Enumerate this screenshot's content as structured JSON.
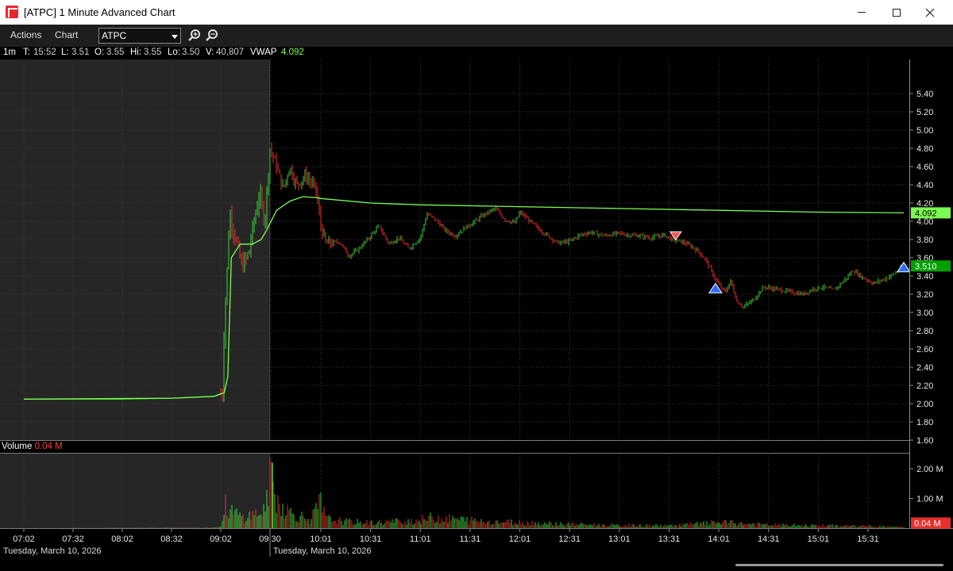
{
  "window": {
    "title": "[ATPC] 1 Minute Advanced Chart"
  },
  "menu": {
    "actions": "Actions",
    "chart": "Chart",
    "symbol": "ATPC"
  },
  "icons": {
    "app": "app-icon",
    "zoom_in": "zoom-in-icon",
    "zoom_out": "zoom-out-icon",
    "minimize": "minimize-icon",
    "maximize": "maximize-icon",
    "close": "close-icon"
  },
  "info": {
    "interval": "1m",
    "t_label": "T:",
    "t_value": "15:52",
    "l_label": "L:",
    "l_value": "3.51",
    "o_label": "O:",
    "o_value": "3.55",
    "hi_label": "Hi:",
    "hi_value": "3.55",
    "lo_label": "Lo:",
    "lo_value": "3.50",
    "v_label": "V:",
    "v_value": "40,807",
    "vwap_label": "VWAP",
    "vwap_value": "4.092"
  },
  "volume_panel": {
    "label": "Volume",
    "value": "0.04 M"
  },
  "dates": {
    "premarket": "Tuesday, March 10, 2026",
    "regular": "Tuesday, March 10, 2026"
  },
  "colors": {
    "up": "#3cd23c",
    "down": "#e8302c",
    "vwap": "#7cfc52",
    "premarket_bg": "#262626",
    "grid": "#3a3a3a",
    "last_price_badge": "#00a000",
    "volume_badge": "#e8302c",
    "buy_marker": "#2f6bff",
    "sell_marker": "#ff5050"
  },
  "chart_data": [
    {
      "type": "candlestick",
      "title": "",
      "symbol": "ATPC",
      "interval": "1m",
      "ylim": [
        1.6,
        5.5
      ],
      "y_ticks": [
        "5.40",
        "5.20",
        "5.00",
        "4.80",
        "4.60",
        "4.40",
        "4.20",
        "4.00",
        "3.80",
        "3.60",
        "3.40",
        "3.20",
        "3.00",
        "2.80",
        "2.60",
        "2.40",
        "2.20",
        "2.00",
        "1.80",
        "1.60"
      ],
      "x_ticks": [
        "07:02",
        "07:32",
        "08:02",
        "08:32",
        "09:02",
        "09:30",
        "10:01",
        "10:31",
        "11:01",
        "11:31",
        "12:01",
        "12:31",
        "13:01",
        "13:31",
        "14:01",
        "14:31",
        "15:01",
        "15:31"
      ],
      "last_price": "3.510",
      "vwap_last": "4.092",
      "price_path": [
        [
          "07:02",
          2.05
        ],
        [
          "07:32",
          2.05
        ],
        [
          "08:02",
          2.05
        ],
        [
          "08:32",
          2.06
        ],
        [
          "08:58",
          2.08
        ],
        [
          "09:03",
          2.12
        ],
        [
          "09:04",
          2.9
        ],
        [
          "09:06",
          3.6
        ],
        [
          "09:07",
          4.1
        ],
        [
          "09:10",
          3.85
        ],
        [
          "09:14",
          3.5
        ],
        [
          "09:18",
          3.65
        ],
        [
          "09:20",
          3.9
        ],
        [
          "09:24",
          4.3
        ],
        [
          "09:27",
          4.0
        ],
        [
          "09:30",
          4.8
        ],
        [
          "09:34",
          4.6
        ],
        [
          "09:38",
          4.35
        ],
        [
          "09:42",
          4.6
        ],
        [
          "09:46",
          4.4
        ],
        [
          "09:52",
          4.5
        ],
        [
          "09:58",
          4.35
        ],
        [
          "10:01",
          3.95
        ],
        [
          "10:04",
          3.75
        ],
        [
          "10:12",
          3.78
        ],
        [
          "10:18",
          3.62
        ],
        [
          "10:24",
          3.7
        ],
        [
          "10:31",
          3.84
        ],
        [
          "10:36",
          3.95
        ],
        [
          "10:42",
          3.75
        ],
        [
          "10:48",
          3.82
        ],
        [
          "10:54",
          3.7
        ],
        [
          "11:01",
          3.82
        ],
        [
          "11:05",
          4.08
        ],
        [
          "11:10",
          4.02
        ],
        [
          "11:16",
          3.9
        ],
        [
          "11:22",
          3.84
        ],
        [
          "11:28",
          3.93
        ],
        [
          "11:34",
          4.0
        ],
        [
          "11:40",
          4.08
        ],
        [
          "11:46",
          4.14
        ],
        [
          "11:52",
          4.02
        ],
        [
          "11:58",
          3.98
        ],
        [
          "12:01",
          4.1
        ],
        [
          "12:06",
          4.02
        ],
        [
          "12:12",
          3.92
        ],
        [
          "12:18",
          3.84
        ],
        [
          "12:24",
          3.76
        ],
        [
          "12:31",
          3.78
        ],
        [
          "12:37",
          3.85
        ],
        [
          "12:44",
          3.88
        ],
        [
          "12:52",
          3.84
        ],
        [
          "13:01",
          3.87
        ],
        [
          "13:06",
          3.85
        ],
        [
          "13:14",
          3.84
        ],
        [
          "13:20",
          3.82
        ],
        [
          "13:28",
          3.85
        ],
        [
          "13:33",
          3.8
        ],
        [
          "13:38",
          3.78
        ],
        [
          "13:43",
          3.74
        ],
        [
          "13:48",
          3.68
        ],
        [
          "13:53",
          3.58
        ],
        [
          "13:58",
          3.4
        ],
        [
          "14:01",
          3.3
        ],
        [
          "14:05",
          3.22
        ],
        [
          "14:08",
          3.35
        ],
        [
          "14:12",
          3.12
        ],
        [
          "14:16",
          3.06
        ],
        [
          "14:22",
          3.14
        ],
        [
          "14:28",
          3.28
        ],
        [
          "14:34",
          3.26
        ],
        [
          "14:40",
          3.24
        ],
        [
          "14:46",
          3.22
        ],
        [
          "14:52",
          3.2
        ],
        [
          "14:58",
          3.26
        ],
        [
          "15:04",
          3.28
        ],
        [
          "15:10",
          3.24
        ],
        [
          "15:16",
          3.34
        ],
        [
          "15:22",
          3.46
        ],
        [
          "15:28",
          3.38
        ],
        [
          "15:34",
          3.32
        ],
        [
          "15:40",
          3.36
        ],
        [
          "15:46",
          3.42
        ],
        [
          "15:52",
          3.51
        ]
      ],
      "vwap_path": [
        [
          "07:02",
          2.05
        ],
        [
          "08:32",
          2.06
        ],
        [
          "08:58",
          2.08
        ],
        [
          "09:04",
          2.12
        ],
        [
          "09:06",
          2.3
        ],
        [
          "09:08",
          3.6
        ],
        [
          "09:13",
          3.75
        ],
        [
          "09:20",
          3.75
        ],
        [
          "09:25",
          3.8
        ],
        [
          "09:28",
          3.9
        ],
        [
          "09:34",
          4.12
        ],
        [
          "09:42",
          4.22
        ],
        [
          "09:50",
          4.27
        ],
        [
          "09:58",
          4.26
        ],
        [
          "10:01",
          4.25
        ],
        [
          "10:31",
          4.2
        ],
        [
          "11:01",
          4.18
        ],
        [
          "12:01",
          4.16
        ],
        [
          "13:01",
          4.14
        ],
        [
          "14:01",
          4.12
        ],
        [
          "15:01",
          4.1
        ],
        [
          "15:52",
          4.092
        ]
      ],
      "markers": [
        {
          "type": "sell",
          "time": "13:35",
          "price": 3.85
        },
        {
          "type": "buy",
          "time": "13:59",
          "price": 3.25
        },
        {
          "type": "buy",
          "time": "15:52",
          "price": 3.48
        }
      ]
    },
    {
      "type": "bar",
      "title": "Volume",
      "units": "M",
      "ylim": [
        0,
        2.2
      ],
      "y_ticks": [
        "2.00 M",
        "1.00 M"
      ],
      "last_value": "0.04 M",
      "volume_profile": [
        [
          "07:02",
          0.0
        ],
        [
          "08:58",
          0.02
        ],
        [
          "09:02",
          0.05
        ],
        [
          "09:03",
          0.3
        ],
        [
          "09:04",
          0.9
        ],
        [
          "09:06",
          0.7
        ],
        [
          "09:10",
          0.55
        ],
        [
          "09:15",
          0.4
        ],
        [
          "09:20",
          0.5
        ],
        [
          "09:25",
          0.6
        ],
        [
          "09:28",
          0.8
        ],
        [
          "09:30",
          2.2
        ],
        [
          "09:33",
          1.2
        ],
        [
          "09:37",
          0.85
        ],
        [
          "09:42",
          0.6
        ],
        [
          "09:48",
          0.45
        ],
        [
          "09:55",
          0.35
        ],
        [
          "10:01",
          0.95
        ],
        [
          "10:04",
          0.35
        ],
        [
          "10:15",
          0.25
        ],
        [
          "10:31",
          0.2
        ],
        [
          "11:01",
          0.3
        ],
        [
          "11:08",
          0.4
        ],
        [
          "11:31",
          0.3
        ],
        [
          "11:40",
          0.25
        ],
        [
          "12:01",
          0.22
        ],
        [
          "12:31",
          0.15
        ],
        [
          "13:01",
          0.1
        ],
        [
          "13:31",
          0.1
        ],
        [
          "13:55",
          0.18
        ],
        [
          "14:01",
          0.22
        ],
        [
          "14:31",
          0.12
        ],
        [
          "15:01",
          0.1
        ],
        [
          "15:31",
          0.08
        ],
        [
          "15:52",
          0.04
        ]
      ]
    }
  ]
}
